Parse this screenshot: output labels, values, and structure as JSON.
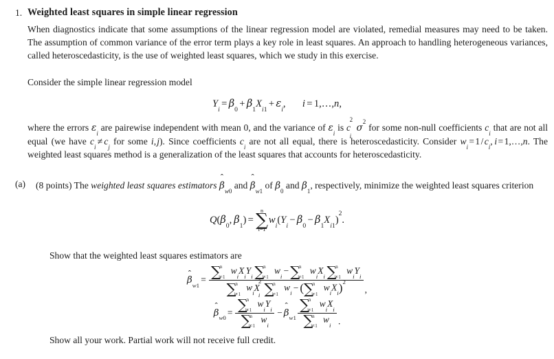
{
  "document": {
    "kind": "homework-problem",
    "item_number": "1.",
    "title": "Weighted least squares in simple linear regression",
    "paragraphs": {
      "intro": "When diagnostics indicate that some assumptions of the linear regression model are violated, remedial measures may need to be taken. The assumption of common variance of the error term plays a key role in least squares. An approach to handling heterogeneous variances, called heteroscedasticity, is the use of weighted least squares, which we study in this exercise.",
      "consider": "Consider the simple linear regression model",
      "show_that": "Show that the weighted least squares estimators are",
      "show_work": "Show all your work. Partial work will not receive full credit."
    },
    "where_paragraph": {
      "seg1": "where the errors ",
      "eps_i": "εi",
      "seg2": " are pairewise independent with mean 0, and the variance of ",
      "eps_i2": "εi",
      "seg3": " is ",
      "variance": "ci²σ²",
      "seg4": " for some non-null coefficients ",
      "c_i": "ci",
      "seg5": " that are not all equal (we have ",
      "neq": "ci ≠ cj",
      "seg6": " for some ",
      "ij": "i, j",
      "seg7": "). Since coefficients ",
      "c_i2": "ci",
      "seg8": " are not all equal, there is heteroscedasticity. Consider ",
      "w_def": "wi = 1/ci, i = 1, …, n",
      "seg9": ". The weighted least squares method is a generalization of the least squares that accounts for heteroscedasticity."
    },
    "part_a": {
      "marker": "(a)",
      "points": "(8 points)",
      "seg1": " The ",
      "emph": "weighted least squares estimators",
      "seg2": " ",
      "beta_w0": "β̂w0",
      "seg3": " and ",
      "beta_w1": "β̂w1",
      "seg4": " of ",
      "beta_0": "β0",
      "seg5": " and ",
      "beta_1": "β1",
      "seg6": ", respectively, minimize the weighted least squares criterion"
    },
    "equations": {
      "model": {
        "latex": "Y_i = \\beta_0 + \\beta_1 X_{i1} + \\varepsilon_i, \\quad i = 1, \\ldots, n,",
        "plain": "Yi = β0 + β1 Xi1 + εi,   i = 1, …, n,"
      },
      "criterion": {
        "latex": "Q(\\beta_0,\\beta_1) = \\sum_{i=1}^{n} w_i (Y_i - \\beta_0 - \\beta_1 X_{i1})^2.",
        "plain": "Q(β0, β1) = Σ i=1..n wi(Yi − β0 − β1 Xi1)²."
      },
      "beta_w1": {
        "latex": "\\widehat{\\beta}_{w1} = \\frac{\\sum_{i=1}^n w_i X_i Y_i \\sum_{i=1}^n w_i - \\sum_{i=1}^n w_i X_i \\sum_{i=1}^n w_i Y_i}{\\sum_{i=1}^n w_i X_i^2 \\sum_{i=1}^n w_i - (\\sum_{i=1}^n w_i X_i)^2},",
        "plain": "β̂w1 = [Σ wiXiYi Σ wi − Σ wiXi Σ wiYi] / [Σ wiXi² Σ wi − (Σ wiXi)²],"
      },
      "beta_w0": {
        "latex": "\\widehat{\\beta}_{w0} = \\frac{\\sum_{i=1}^n w_i Y_i}{\\sum_{i=1}^n w_i} - \\widehat{\\beta}_{w1} \\frac{\\sum_{i=1}^n w_i X_i}{\\sum_{i=1}^n w_i}.",
        "plain": "β̂w0 = (Σ wiYi)/(Σ wi) − β̂w1 (Σ wiXi)/(Σ wi)."
      }
    },
    "symbols": {
      "sigma_sum": "∑",
      "hat": "^",
      "minus": "−",
      "plus": "+",
      "equals": "=",
      "neq": "≠",
      "ldots": "…",
      "comma": ",",
      "period": ".",
      "n": "n",
      "i_eq_1": "i=1",
      "beta": "β",
      "varepsilon": "ε",
      "sigma": "σ",
      "w": "w",
      "X": "X",
      "Y": "Y",
      "Q": "Q",
      "c": "c"
    },
    "colors": {
      "text": "#1a1a1a",
      "background": "#ffffff"
    }
  }
}
